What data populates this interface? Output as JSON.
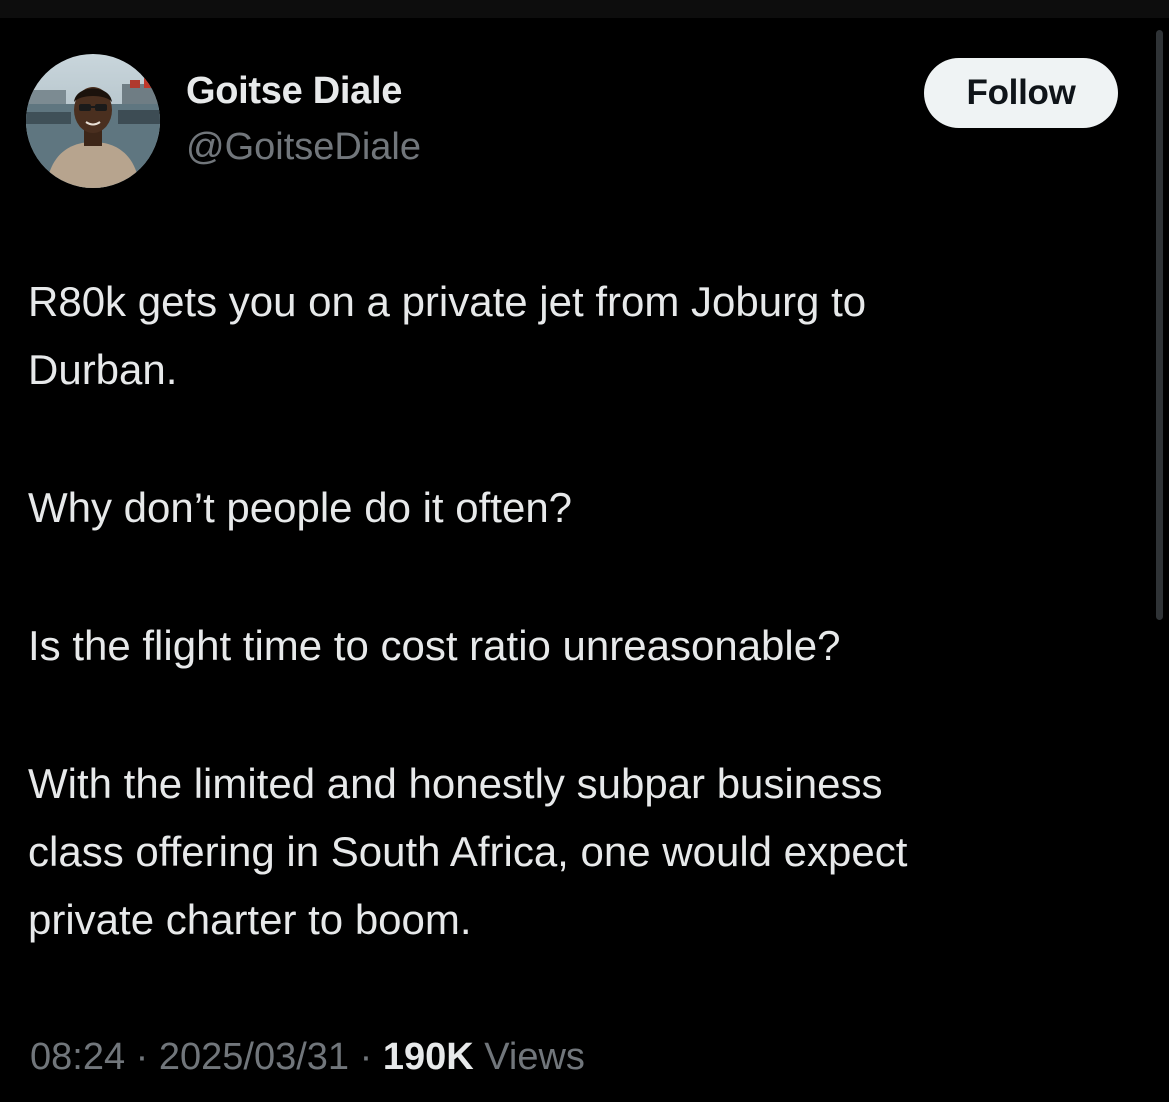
{
  "author": {
    "name": "Goitse Diale",
    "handle": "@GoitseDiale"
  },
  "follow_button": {
    "label": "Follow"
  },
  "tweet": {
    "paragraphs": [
      "R80k gets you on a private jet from Joburg to\nDurban.",
      "Why don’t people do it often?",
      "Is the flight time to cost ratio unreasonable?",
      "With the limited and honestly subpar business\nclass offering in South Africa, one would expect\nprivate charter to boom."
    ]
  },
  "meta": {
    "time": "08:24",
    "separator": "·",
    "date": "2025/03/31",
    "views_count": "190K",
    "views_label": "Views"
  },
  "colors": {
    "background": "#000000",
    "primary_text": "#e7e9ea",
    "secondary_text": "#71767b",
    "follow_button_bg": "#eff3f4"
  }
}
